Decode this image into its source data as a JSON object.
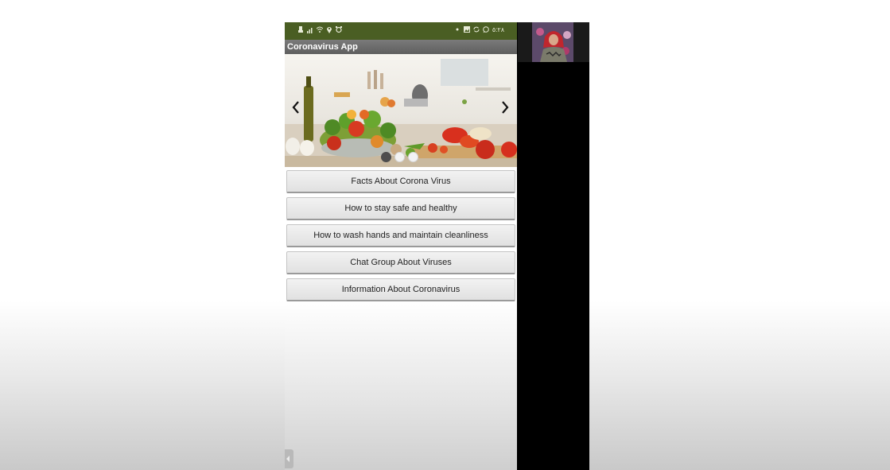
{
  "app": {
    "title": "Coronavirus App"
  },
  "status_bar": {
    "time": "٥:٢٨",
    "left_icons": [
      "usb-icon",
      "signal-icon",
      "wifi-icon",
      "location-icon",
      "alarm-icon"
    ],
    "right_icons": [
      "dot-icon",
      "image-icon",
      "sync-icon",
      "whatsapp-icon"
    ],
    "background_color": "#4a5e23"
  },
  "carousel": {
    "prev_icon": "chevron-left-icon",
    "next_icon": "chevron-right-icon",
    "slide_count": 3,
    "active_index": 0
  },
  "menu": {
    "buttons": [
      {
        "label": "Facts About Corona Virus"
      },
      {
        "label": "How to stay safe and healthy"
      },
      {
        "label": "How to wash hands and maintain cleanliness"
      },
      {
        "label": "Chat Group About Viruses"
      },
      {
        "label": "Information About Coronavirus"
      }
    ]
  },
  "colors": {
    "title_bar": "#6e6e6e",
    "button_text": "#222222",
    "active_dot": "#4d4d4d"
  }
}
